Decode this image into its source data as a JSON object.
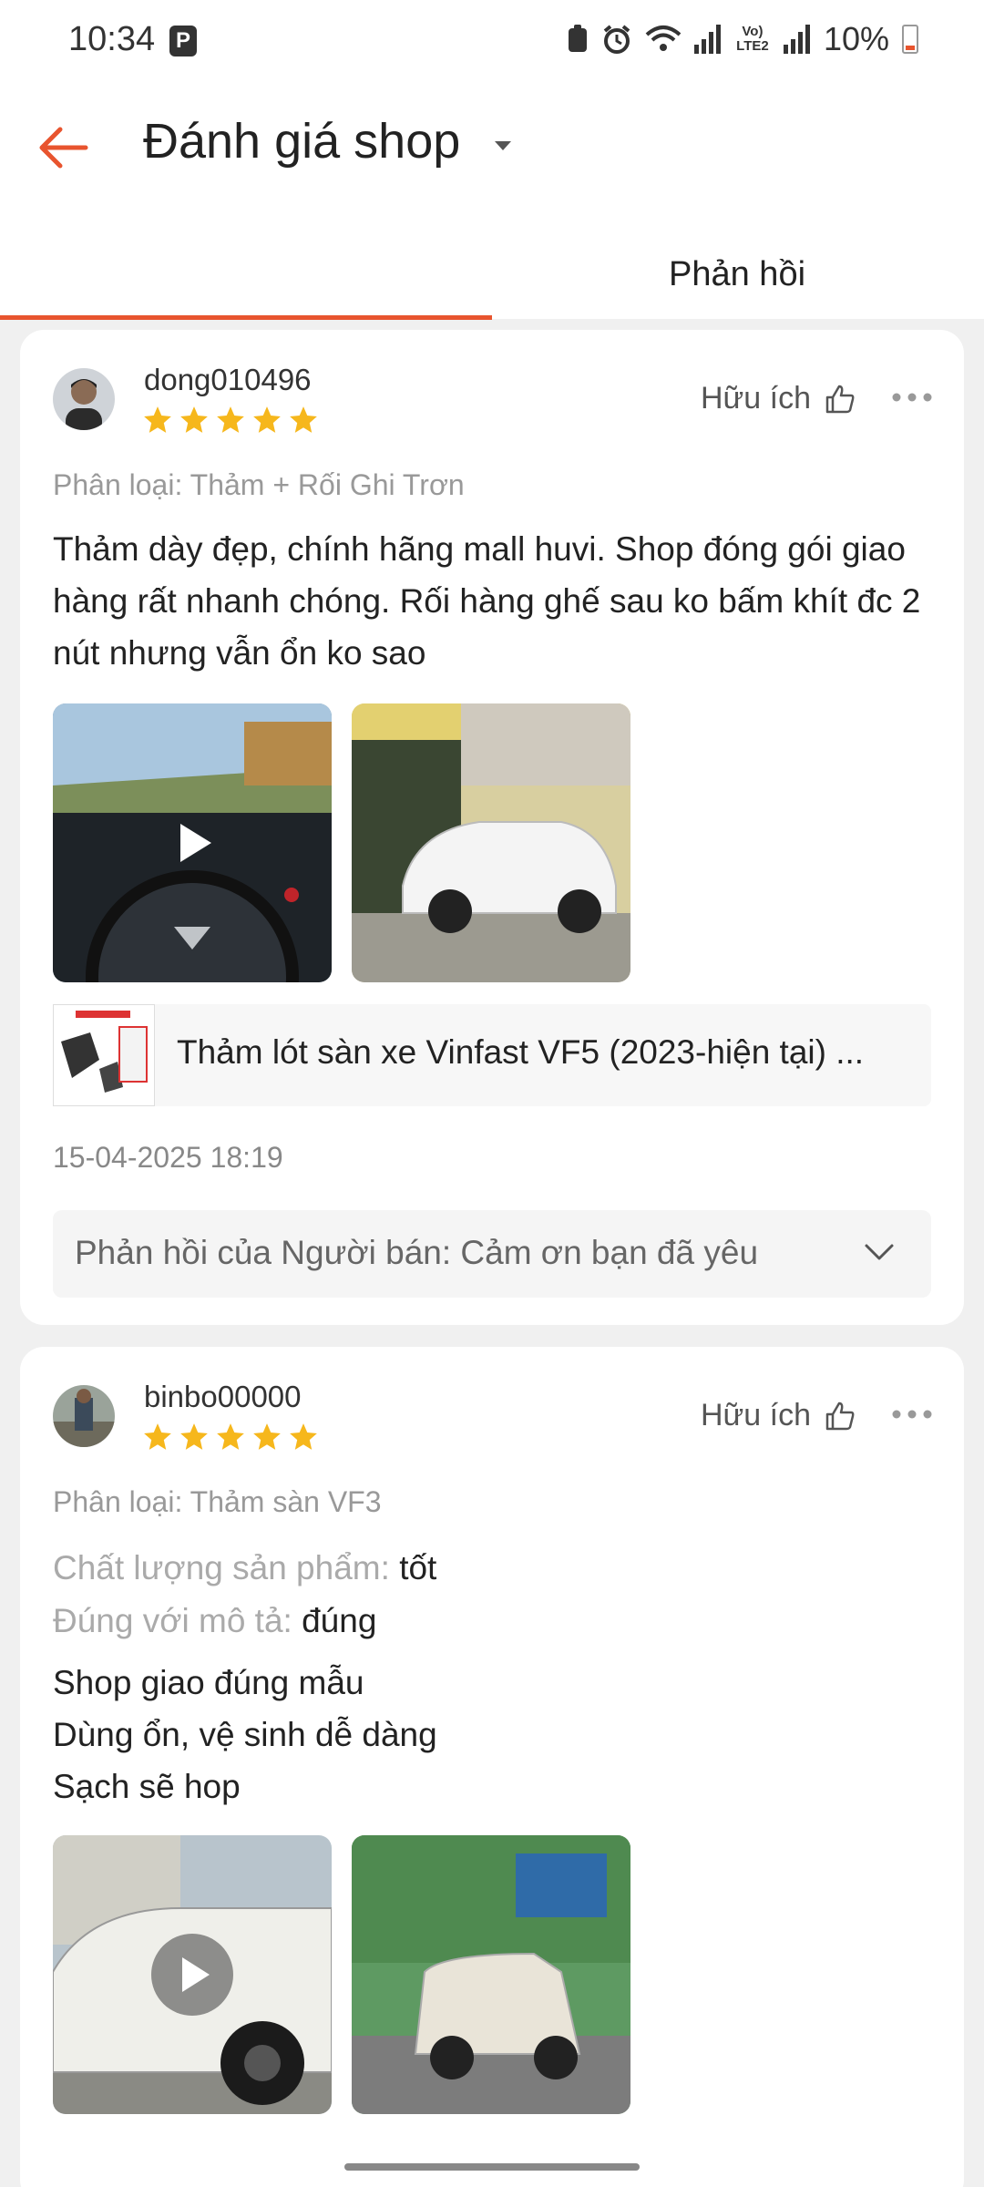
{
  "status_bar": {
    "time": "10:34",
    "p_badge": "P",
    "battery": "10%",
    "lte": "Vo) LTE2"
  },
  "header": {
    "title": "Đánh giá shop",
    "tab_right": "Phản hồi"
  },
  "colors": {
    "accent": "#e8542e",
    "star": "#f6b71c"
  },
  "reviews": [
    {
      "username": "dong010496",
      "rating": 5,
      "helpful": "Hữu ích",
      "variant": "Phân loại: Thảm + Rối Ghi Trơn",
      "text": "Thảm dày đẹp, chính hãng mall huvi. Shop đóng gói giao hàng rất nhanh chóng. Rối hàng ghế sau ko bấm khít đc 2 nút nhưng vẫn ổn ko sao",
      "product": "Thảm lót sàn xe Vinfast VF5 (2023-hiện tại) ...",
      "date": "15-04-2025 18:19",
      "seller_reply": "Phản hồi của Người bán: Cảm ơn bạn đã yêu"
    },
    {
      "username": "binbo00000",
      "rating": 5,
      "helpful": "Hữu ích",
      "variant": "Phân loại: Thảm sàn VF3",
      "attr1_label": "Chất lượng sản phẩm:",
      "attr1_value": "tốt",
      "attr2_label": "Đúng với mô tả:",
      "attr2_value": "đúng",
      "lines": [
        "Shop giao đúng mẫu",
        "Dùng ổn, vệ sinh dễ dàng",
        "Sạch sẽ hop"
      ]
    }
  ]
}
